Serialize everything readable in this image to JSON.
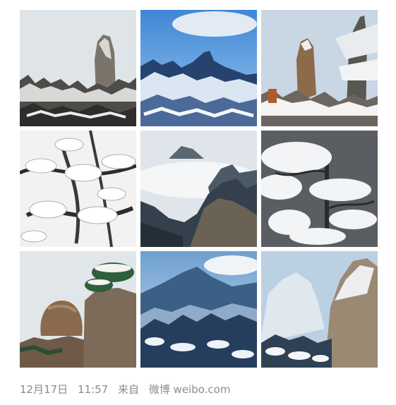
{
  "post": {
    "photos": [
      {
        "alt": "snow-rock-pillar-icon"
      },
      {
        "alt": "snow-peak-blue-sky-icon"
      },
      {
        "alt": "snow-pine-and-pillar-icon"
      },
      {
        "alt": "snow-pine-branches-icon"
      },
      {
        "alt": "sea-of-clouds-peaks-icon"
      },
      {
        "alt": "snow-covered-pine-icon"
      },
      {
        "alt": "balanced-boulder-icon"
      },
      {
        "alt": "snow-mountain-range-icon"
      },
      {
        "alt": "snow-cliff-forest-icon"
      }
    ],
    "meta": {
      "date": "12月17日",
      "time": "11:57",
      "from_label": "来自",
      "source": "微博 weibo.com"
    }
  }
}
